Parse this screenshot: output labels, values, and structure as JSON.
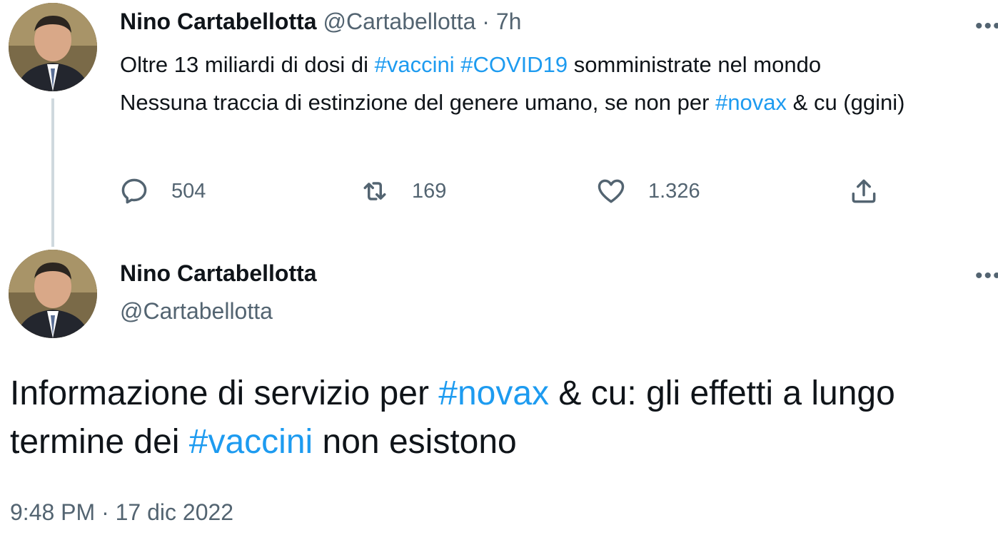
{
  "tweet1": {
    "display_name": "Nino Cartabellotta",
    "handle": "@Cartabellotta",
    "separator": "·",
    "time_ago": "7h",
    "text_part1": "Oltre 13 miliardi di dosi di ",
    "hashtag1": "#vaccini",
    "text_part2": " ",
    "hashtag2": "#COVID19",
    "text_part3": " somministrate nel mondo",
    "text_part4": "Nessuna traccia di estinzione del genere umano, se non per ",
    "hashtag3": "#novax",
    "text_part5": " & cu (ggini)",
    "replies": "504",
    "retweets": "169",
    "likes": "1.326",
    "more": "•••"
  },
  "tweet2": {
    "display_name": "Nino Cartabellotta",
    "handle": "@Cartabellotta",
    "more": "•••",
    "text_part1": "Informazione di servizio per ",
    "hashtag1": "#novax",
    "text_part2": " & cu: gli effetti a lungo termine dei ",
    "hashtag2": "#vaccini",
    "text_part3": " non esistono",
    "timestamp": "9:48 PM · 17 dic 2022"
  },
  "colors": {
    "hashtag": "#1d9bf0",
    "muted": "#536471",
    "text": "#0f1419",
    "thread_line": "#cfd9de"
  },
  "icons": [
    "reply-icon",
    "retweet-icon",
    "like-icon",
    "share-icon",
    "more-icon"
  ]
}
